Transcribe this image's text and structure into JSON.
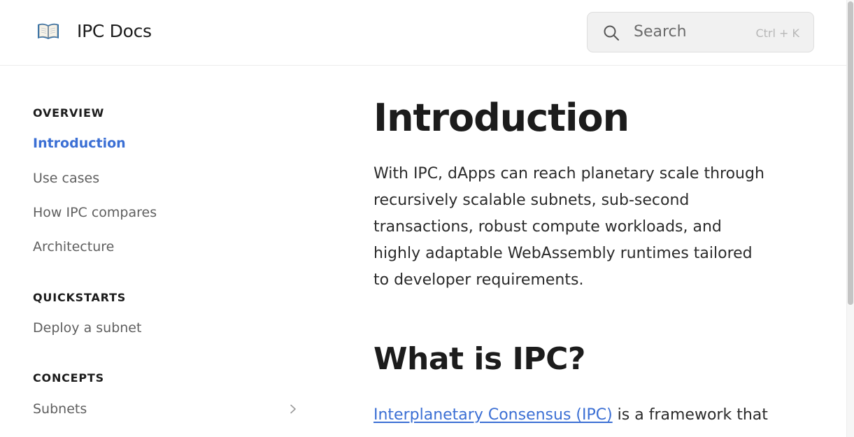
{
  "header": {
    "logo_icon": "open-book-icon",
    "title": "IPC Docs",
    "search": {
      "placeholder": "Search",
      "shortcut": "Ctrl + K",
      "icon": "search-icon"
    }
  },
  "sidebar": {
    "sections": [
      {
        "heading": "OVERVIEW",
        "items": [
          {
            "label": "Introduction",
            "active": true
          },
          {
            "label": "Use cases"
          },
          {
            "label": "How IPC compares"
          },
          {
            "label": "Architecture"
          }
        ]
      },
      {
        "heading": "QUICKSTARTS",
        "items": [
          {
            "label": "Deploy a subnet"
          }
        ]
      },
      {
        "heading": "CONCEPTS",
        "items": [
          {
            "label": "Subnets",
            "expandable": true
          }
        ]
      }
    ]
  },
  "main": {
    "title": "Introduction",
    "intro": "With IPC, dApps can reach planetary scale through recursively scalable subnets, sub-second transactions, robust compute workloads, and highly adaptable WebAssembly runtimes tailored to developer requirements.",
    "section_title": "What is IPC?",
    "ipc_link": "Interplanetary Consensus (IPC)",
    "ipc_text": " is a framework that"
  },
  "colors": {
    "accent": "#3b6fd4",
    "text": "#1c1c1c",
    "muted": "#5f5f5f",
    "search_bg": "#f1f1f1"
  }
}
